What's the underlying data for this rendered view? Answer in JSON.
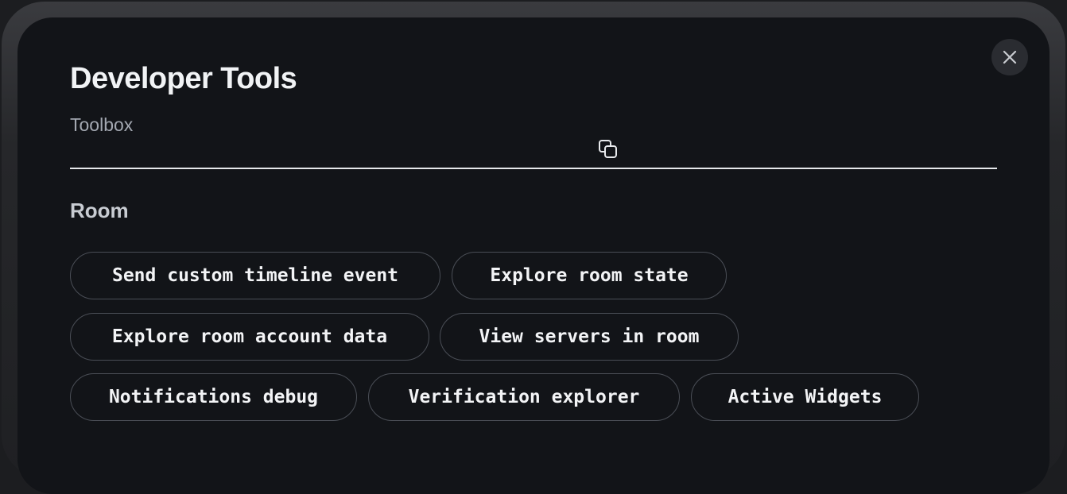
{
  "dialog": {
    "title": "Developer Tools",
    "subtitle": "Toolbox",
    "close_icon": "close-icon",
    "copy_icon": "copy-icon"
  },
  "section": {
    "heading": "Room",
    "buttons": [
      "Send custom timeline event",
      "Explore room state",
      "Explore room account data",
      "View servers in room",
      "Notifications debug",
      "Verification explorer",
      "Active Widgets"
    ]
  },
  "colors": {
    "background": "#121418",
    "text": "#ebeef2",
    "muted": "#a3a8b1",
    "border": "#4a4e56"
  }
}
